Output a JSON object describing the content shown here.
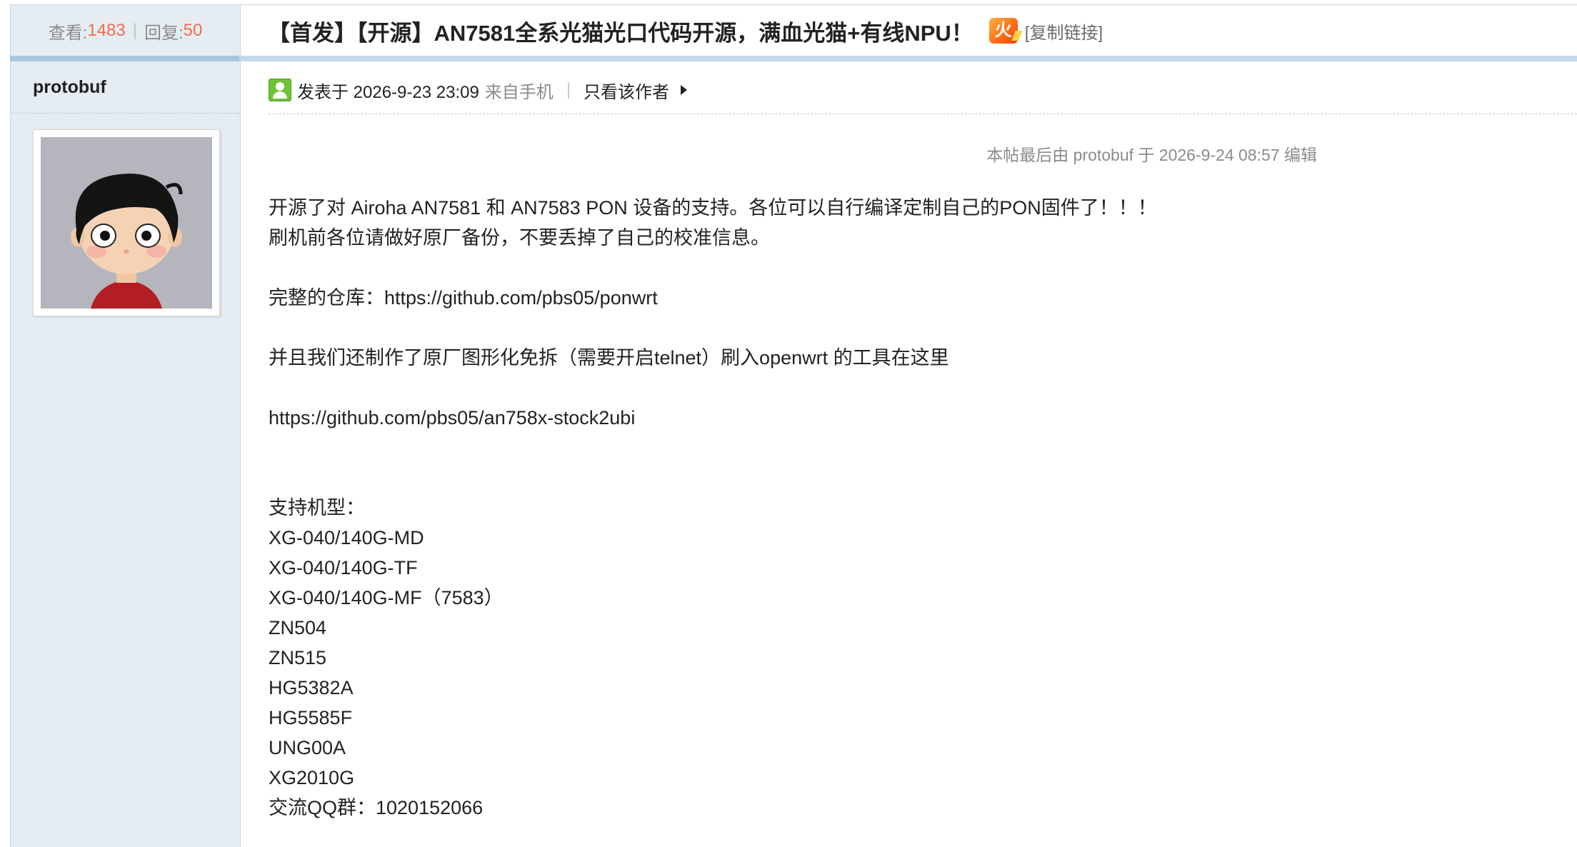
{
  "header": {
    "views_label": "查看:",
    "views": "1483",
    "replies_label": "回复:",
    "replies": "50",
    "stats_separator": "|",
    "title": "【首发】【开源】AN7581全系光猫光口代码开源，满血光猫+有线NPU！",
    "hot_icon_text": "火",
    "copy_link": "[复制链接]"
  },
  "author": {
    "name": "protobuf",
    "avatar_icon": "cartoon-avatar-icon"
  },
  "post": {
    "posted_at": "发表于 2026-9-23 23:09",
    "from": "来自手机",
    "meta_separator": "|",
    "only_author": "只看该作者",
    "edit_note": "本帖最后由 protobuf 于 2026-9-24 08:57 编辑",
    "lines": [
      "开源了对 Airoha AN7581 和 AN7583 PON 设备的支持。各位可以自行编译定制自己的PON固件了！！！",
      "刷机前各位请做好原厂备份，不要丢掉了自己的校准信息。",
      "",
      "完整的仓库：https://github.com/pbs05/ponwrt",
      "",
      "并且我们还制作了原厂图形化免拆（需要开启telnet）刷入openwrt 的工具在这里",
      "",
      "https://github.com/pbs05/an758x-stock2ubi",
      "",
      "",
      "支持机型：",
      "XG-040/140G-MD",
      "XG-040/140G-TF",
      "XG-040/140G-MF（7583）",
      "ZN504",
      "ZN515",
      "HG5382A",
      "HG5585F",
      "UNG00A",
      "XG2010G",
      "交流QQ群：1020152066"
    ]
  },
  "colors": {
    "accent_number": "#f26c4f",
    "sidebar_bg": "#e5edf2",
    "muted_text": "#8b8b8b"
  }
}
